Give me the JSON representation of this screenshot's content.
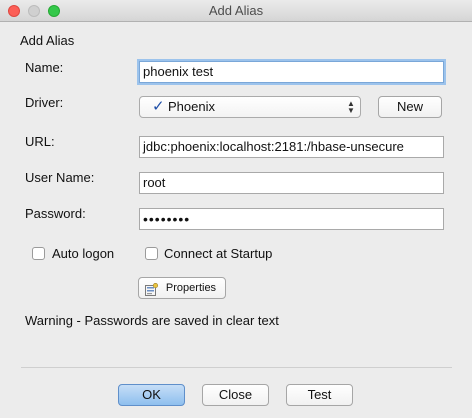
{
  "window": {
    "title": "Add Alias"
  },
  "section_title": "Add Alias",
  "form": {
    "name_label": "Name:",
    "name_value": "phoenix test",
    "driver_label": "Driver:",
    "driver_check": "✓",
    "driver_value": "Phoenix",
    "new_button": "New",
    "url_label": "URL:",
    "url_value": "jdbc:phoenix:localhost:2181:/hbase-unsecure",
    "username_label": "User Name:",
    "username_value": "root",
    "password_label": "Password:",
    "password_value": "••••••••",
    "auto_logon_label": "Auto logon",
    "auto_logon_checked": false,
    "connect_startup_label": "Connect at Startup",
    "connect_startup_checked": false,
    "properties_button": "Properties"
  },
  "warning": "Warning - Passwords are saved in clear text",
  "buttons": {
    "ok": "OK",
    "close": "Close",
    "test": "Test"
  },
  "icons": {
    "close_window": "close-window-icon",
    "minimize_window": "minimize-window-icon",
    "maximize_window": "maximize-window-icon",
    "properties": "properties-icon",
    "dropdown": "dropdown-arrows-icon"
  },
  "colors": {
    "focus_ring": "#9cc3ec",
    "default_button": "#8ebfee",
    "check_mark": "#1f4fa8"
  }
}
